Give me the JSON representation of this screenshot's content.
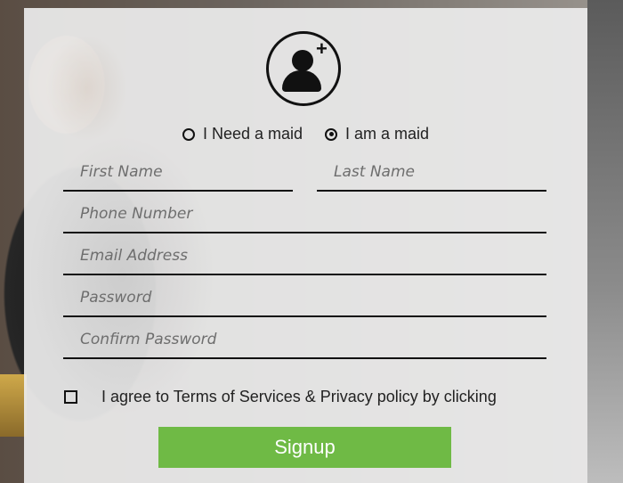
{
  "roles": {
    "options": [
      {
        "label": "I Need a maid",
        "selected": false
      },
      {
        "label": "I am a maid",
        "selected": true
      }
    ]
  },
  "form": {
    "first_name_placeholder": "First Name",
    "last_name_placeholder": "Last Name",
    "phone_placeholder": "Phone Number",
    "email_placeholder": "Email Address",
    "password_placeholder": "Password",
    "confirm_password_placeholder": "Confirm Password"
  },
  "terms": {
    "label": "I agree to Terms of Services & Privacy policy by clicking",
    "checked": false
  },
  "signup": {
    "label": "Signup"
  },
  "icons": {
    "avatar": "add-user-icon"
  },
  "colors": {
    "button": "#6fba45",
    "panel": "#ececec"
  }
}
